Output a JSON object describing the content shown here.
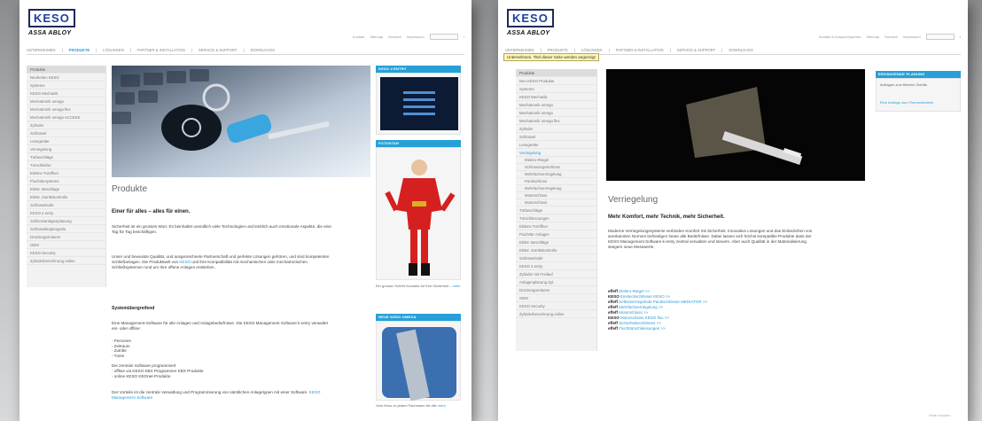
{
  "left": {
    "logo": {
      "brand": "KESO",
      "sub": "ASSA ABLOY"
    },
    "utility": [
      "Kontakt",
      "Sitemap",
      "Deutsch",
      "Impressum"
    ],
    "utility_go": "",
    "topnav": [
      {
        "label": "UNTERNEHMEN",
        "active": false
      },
      {
        "label": "PRODUKTE",
        "active": true
      },
      {
        "label": "LÖSUNGEN",
        "active": false
      },
      {
        "label": "PARTNER & INSTALLATION",
        "active": false
      },
      {
        "label": "SERVICE & SUPPORT",
        "active": false
      },
      {
        "label": "DOWNLOADS",
        "active": false
      }
    ],
    "sidebar": [
      {
        "label": "Produkte",
        "kind": "head"
      },
      {
        "label": "Neuheiten KESO",
        "kind": ""
      },
      {
        "label": "Systeme",
        "kind": ""
      },
      {
        "label": "KESO Mechanik",
        "kind": ""
      },
      {
        "label": "Mechatronik omega",
        "kind": ""
      },
      {
        "label": "Mechatronik omega flex",
        "kind": ""
      },
      {
        "label": "Mechatronik omega ACCESS",
        "kind": ""
      },
      {
        "label": "Zylinder",
        "kind": ""
      },
      {
        "label": "Schlüssel",
        "kind": ""
      },
      {
        "label": "Lesegeräte",
        "kind": ""
      },
      {
        "label": "Verriegelung",
        "kind": ""
      },
      {
        "label": "Türbeschläge",
        "kind": ""
      },
      {
        "label": "Türschließer",
        "kind": ""
      },
      {
        "label": "Elektro-Türöffner",
        "kind": ""
      },
      {
        "label": "Fluchttürsysteme",
        "kind": ""
      },
      {
        "label": "Elektr. Beschläge",
        "kind": ""
      },
      {
        "label": "Elektr. Zutrittskontrolle",
        "kind": ""
      },
      {
        "label": "Schlüsselsafe",
        "kind": ""
      },
      {
        "label": "KESO 4 entry",
        "kind": ""
      },
      {
        "label": "Schliessanlagenplanung",
        "kind": ""
      },
      {
        "label": "Schlüsselkopiergerät",
        "kind": ""
      },
      {
        "label": "Drückergarnituren",
        "kind": ""
      },
      {
        "label": "OEM",
        "kind": ""
      },
      {
        "label": "KESO Security",
        "kind": ""
      },
      {
        "label": "Zylinderberechnung online",
        "kind": ""
      }
    ],
    "title": "Produkte",
    "subtitle": "Einer für alles – alles für einen.",
    "para1": "Sicherheit ist ein grosses Wort. Es beinhaltet unendlich viele Technologien und letztlich auch emotionale Aspekte, die eine Tag für Tag beschäftigen.",
    "para2_a": "Unser und bewusste Qualität, und ausgezeichnete Partnerschaft und perfekte Lösungen gehören, und sind kompetenten Schließanlagen. Die Produktwelt von ",
    "para2_link": "KESO",
    "para2_b": " und ihre Kompatibilität mit mechanischen oder mechatronischen Schließsystemen rund um Ihre offene Anlagen entstehen.",
    "section": "Systemübergreifend",
    "para3": "Eine Management-Software für alle Anlagen und Anlagebedürfnisse. Die KESO Management Software k-entry verwaltet ein- oder offline:",
    "bullets": [
      "- Personen",
      "- Zeitraum",
      "- Zutritte",
      "- Türen"
    ],
    "para4": "Die zentrale Software programmiert\n- offline via KESO KBX Programmer KBX Produkte\n- online KESO KEOnet-Produkte",
    "para5_a": "Der Vorteile ist die zentrale Verwaltung und Programmierung von sämtlichen Anlagetypen mit einer Software. ",
    "para5_link": "KESO Management Software",
    "widgets": [
      {
        "head": "KESO 4 ENTRY"
      },
      {
        "head": "FOTOSTAR",
        "caption_a": "Ein grosser Schritt Vorwärts für Ihre Sicherheit – ",
        "caption_link": "mehr"
      },
      {
        "head": "NEUE KESO OMEGA",
        "caption_a": "Vom Keso zu jedem Fachmann für alle ",
        "caption_link": "mehr"
      }
    ]
  },
  "right": {
    "logo": {
      "brand": "KESO",
      "sub": "ASSA ABLOY"
    },
    "utility": [
      "Kontakt & Ansprechpartner",
      "Sitemap",
      "Deutsch",
      "Impressum"
    ],
    "topnav": [
      {
        "label": "UNTERNEHMEN",
        "active": false
      },
      {
        "label": "PRODUKTE",
        "active": false
      },
      {
        "label": "LÖSUNGEN",
        "active": false
      },
      {
        "label": "PARTNER & INSTALLATION",
        "active": false
      },
      {
        "label": "SERVICE & SUPPORT",
        "active": false
      },
      {
        "label": "DOWNLOADS",
        "active": false
      }
    ],
    "tooltip": "Unternehmen. Titel dieser Seite werden angezeigt",
    "sidebar": [
      {
        "label": "Produkte",
        "kind": "head"
      },
      {
        "label": "Neu KESO Produkte",
        "kind": ""
      },
      {
        "label": "Systeme",
        "kind": ""
      },
      {
        "label": "KESO Mechanik",
        "kind": ""
      },
      {
        "label": "Mechatronik omega",
        "kind": ""
      },
      {
        "label": "Mechatronik omega",
        "kind": ""
      },
      {
        "label": "Mechatronik omega flex",
        "kind": ""
      },
      {
        "label": "Zylinder",
        "kind": ""
      },
      {
        "label": "Schlüssel",
        "kind": ""
      },
      {
        "label": "Lesegeräte",
        "kind": ""
      },
      {
        "label": "Verriegelung",
        "kind": "active"
      },
      {
        "label": "Elektro-Riegel",
        "kind": "sub"
      },
      {
        "label": "Schlossriegelschloss",
        "kind": "sub"
      },
      {
        "label": "Mehrfachverriegelung",
        "kind": "sub"
      },
      {
        "label": "Panikschloss",
        "kind": "sub"
      },
      {
        "label": "Mehrfachverriegelung",
        "kind": "sub"
      },
      {
        "label": "Motorschloss",
        "kind": "sub"
      },
      {
        "label": "Motorschloss",
        "kind": "sub"
      },
      {
        "label": "Türbeschläge",
        "kind": ""
      },
      {
        "label": "Türschliessungen",
        "kind": ""
      },
      {
        "label": "Elektro-Türöffner",
        "kind": ""
      },
      {
        "label": "Fluchttür-Anlagen",
        "kind": ""
      },
      {
        "label": "Elektr. Beschläge",
        "kind": ""
      },
      {
        "label": "Elektr. Zutrittskontrolle",
        "kind": ""
      },
      {
        "label": "Schlüsselsafe",
        "kind": ""
      },
      {
        "label": "KESO 4 entry",
        "kind": ""
      },
      {
        "label": "Zylinder mit Freilauf",
        "kind": ""
      },
      {
        "label": "Anlagenplanung Zyl.",
        "kind": ""
      },
      {
        "label": "Drückergarnituren",
        "kind": ""
      },
      {
        "label": "OEM",
        "kind": ""
      },
      {
        "label": "KESO Security",
        "kind": ""
      },
      {
        "label": "Zylinderberechnung online",
        "kind": ""
      }
    ],
    "title": "Verriegelung",
    "subtitle": "Mehr Komfort, mehr Technik, mehr Sicherheit.",
    "para1": "Moderne Verriegelungssysteme verbinden Komfort mit Sicherheit. Innovative Lösungen und das Einbeziehen von anerkannten Normen befriedigen heute alle Bedürfnisse. Dabei lassen sich höchst kompatible Produkte dank der KESO Management Software k-entry zentral verwalten und steuern. Aber auch Qualität in der Materialisierung steigern neue Messwerte.",
    "links": [
      {
        "brand": "effeff",
        "text": "Elektro-Riegel >>"
      },
      {
        "brand": "KESO",
        "text": "Einsteckschlösser KESO >>"
      },
      {
        "brand": "effeff",
        "text": "Selbstverriegelnde Panikschlösser MEDIATOR >>"
      },
      {
        "brand": "effeff",
        "text": "Mehrfachverriegelung >>"
      },
      {
        "brand": "effeff",
        "text": "Motorschloss >>"
      },
      {
        "brand": "KESO",
        "text": "Motorschloss KESO flux >>"
      },
      {
        "brand": "effeff",
        "text": "Sicherheitsschlösser >>"
      },
      {
        "brand": "effeff",
        "text": "Fluchttürschliessungen >>"
      }
    ],
    "widget": {
      "head": "ERGÄNZENDE PLANUNG",
      "caption": "Anfragen zum Bereich Zutritts",
      "link": "Eine Anfrage zum Themenbereich"
    },
    "footer": "Seite drucken"
  }
}
